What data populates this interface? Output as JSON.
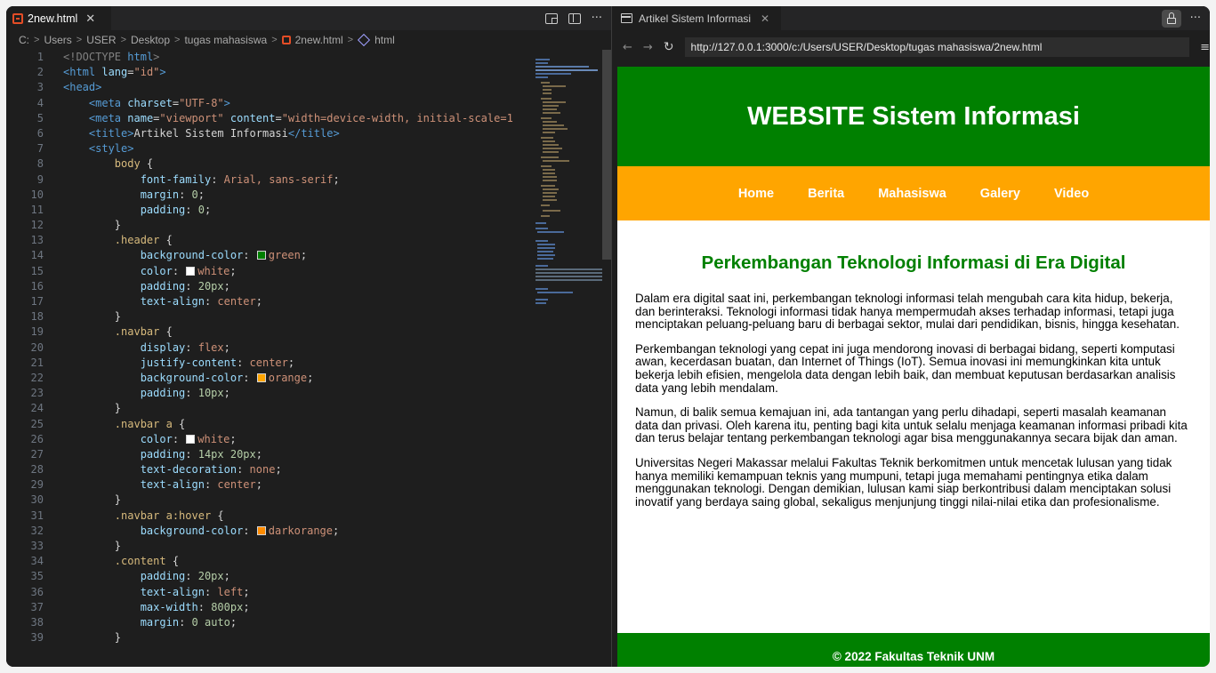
{
  "editor": {
    "tab": {
      "file": "2new.html",
      "close": "✕"
    },
    "actions": {
      "more": "···"
    },
    "breadcrumb": [
      "C:",
      "Users",
      "USER",
      "Desktop",
      "tugas mahasiswa",
      "2new.html",
      "html"
    ],
    "breadcrumb_sep": ">",
    "line_numbers": [
      "1",
      "2",
      "3",
      "4",
      "5",
      "6",
      "7",
      "8",
      "9",
      "10",
      "11",
      "12",
      "13",
      "14",
      "15",
      "16",
      "17",
      "18",
      "19",
      "20",
      "21",
      "22",
      "23",
      "24",
      "25",
      "26",
      "27",
      "28",
      "29",
      "30",
      "31",
      "32",
      "33",
      "34",
      "35",
      "36",
      "37",
      "38",
      "39"
    ],
    "swatches": {
      "green": "#008000",
      "white": "#ffffff",
      "orange": "#ffa500",
      "darkorange": "#ff8c00"
    },
    "code": {
      "l1_doctype": "<!DOCTYPE",
      "l1_html": "html",
      "l1_close": ">",
      "l2_open": "<html",
      "l2_attr": "lang",
      "l2_val": "\"id\"",
      "l2_close": ">",
      "l3": "<head>",
      "l4_open": "<meta",
      "l4_attr": "charset",
      "l4_val": "\"UTF-8\"",
      "l4_close": ">",
      "l5_open": "<meta",
      "l5_attr1": "name",
      "l5_val1": "\"viewport\"",
      "l5_attr2": "content",
      "l5_val2": "\"width=device-width, initial-scale=1",
      "l6_open": "<title>",
      "l6_text": "Artikel Sistem Informasi",
      "l6_close": "</title>",
      "l7": "<style>",
      "l8_sel": "body",
      "l9_prop": "font-family",
      "l9_val": "Arial, sans-serif",
      "l10_prop": "margin",
      "l10_val": "0",
      "l11_prop": "padding",
      "l11_val": "0",
      "l13_sel": ".header",
      "l14_prop": "background-color",
      "l14_val": "green",
      "l15_prop": "color",
      "l15_val": "white",
      "l16_prop": "padding",
      "l16_val": "20px",
      "l17_prop": "text-align",
      "l17_val": "center",
      "l19_sel": ".navbar",
      "l20_prop": "display",
      "l20_val": "flex",
      "l21_prop": "justify-content",
      "l21_val": "center",
      "l22_prop": "background-color",
      "l22_val": "orange",
      "l23_prop": "padding",
      "l23_val": "10px",
      "l25_sel": ".navbar a",
      "l26_prop": "color",
      "l26_val": "white",
      "l27_prop": "padding",
      "l27_val": "14px 20px",
      "l28_prop": "text-decoration",
      "l28_val": "none",
      "l29_prop": "text-align",
      "l29_val": "center",
      "l31_sel": ".navbar a:hover",
      "l32_prop": "background-color",
      "l32_val": "darkorange",
      "l34_sel": ".content",
      "l35_prop": "padding",
      "l35_val": "20px",
      "l36_prop": "text-align",
      "l36_val": "left",
      "l37_prop": "max-width",
      "l37_val": "800px",
      "l38_prop": "margin",
      "l38_val": "0 auto"
    }
  },
  "browser": {
    "tab_title": "Artikel Sistem Informasi",
    "tab_close": "✕",
    "more": "···",
    "back": "←",
    "forward": "→",
    "reload": "↻",
    "url": "http://127.0.0.1:3000/c:/Users/USER/Desktop/tugas mahasiswa/2new.html",
    "menu": "≡"
  },
  "site": {
    "title": "WEBSITE Sistem Informasi",
    "nav": [
      "Home",
      "Berita",
      "Mahasiswa",
      "Galery",
      "Video"
    ],
    "article_title": "Perkembangan Teknologi Informasi di Era Digital",
    "paragraphs": [
      "Dalam era digital saat ini, perkembangan teknologi informasi telah mengubah cara kita hidup, bekerja, dan berinteraksi. Teknologi informasi tidak hanya mempermudah akses terhadap informasi, tetapi juga menciptakan peluang-peluang baru di berbagai sektor, mulai dari pendidikan, bisnis, hingga kesehatan.",
      "Perkembangan teknologi yang cepat ini juga mendorong inovasi di berbagai bidang, seperti komputasi awan, kecerdasan buatan, dan Internet of Things (IoT). Semua inovasi ini memungkinkan kita untuk bekerja lebih efisien, mengelola data dengan lebih baik, dan membuat keputusan berdasarkan analisis data yang lebih mendalam.",
      "Namun, di balik semua kemajuan ini, ada tantangan yang perlu dihadapi, seperti masalah keamanan data dan privasi. Oleh karena itu, penting bagi kita untuk selalu menjaga keamanan informasi pribadi kita dan terus belajar tentang perkembangan teknologi agar bisa menggunakannya secara bijak dan aman.",
      "Universitas Negeri Makassar melalui Fakultas Teknik berkomitmen untuk mencetak lulusan yang tidak hanya memiliki kemampuan teknis yang mumpuni, tetapi juga memahami pentingnya etika dalam menggunakan teknologi. Dengan demikian, lulusan kami siap berkontribusi dalam menciptakan solusi inovatif yang berdaya saing global, sekaligus menjunjung tinggi nilai-nilai etika dan profesionalisme."
    ],
    "footer": "© 2022 Fakultas Teknik UNM",
    "colors": {
      "header": "#008000",
      "navbar": "#ffa500",
      "footer": "#008000"
    }
  }
}
